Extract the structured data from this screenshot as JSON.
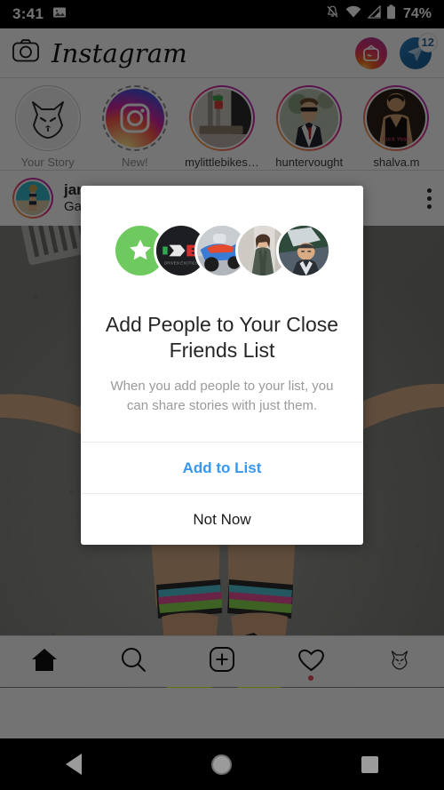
{
  "status_bar": {
    "time": "3:41",
    "icons": [
      "photo-icon",
      "notifications-off-icon",
      "wifi-icon",
      "cellular-signal-icon",
      "battery-icon"
    ],
    "battery_text": "74%"
  },
  "app_header": {
    "camera_icon": "camera-icon",
    "title": "Instagram",
    "igtv_icon": "igtv-icon",
    "direct_icon": "direct-messages-icon",
    "direct_badge": "12"
  },
  "stories": [
    {
      "label": "Your Story",
      "avatar": "wolf-avatar",
      "ring": "plain"
    },
    {
      "label": "New!",
      "avatar": "instagram-glyph-avatar",
      "ring": "dashed"
    },
    {
      "label": "mylittlebikes…",
      "avatar": "bike-photo-avatar",
      "ring": "gradient"
    },
    {
      "label": "huntervought",
      "avatar": "man-suit-photo-avatar",
      "ring": "gradient"
    },
    {
      "label": "shalva.m",
      "avatar": "man-tanktop-photo-avatar",
      "ring": "gradient"
    }
  ],
  "post": {
    "username": "jan",
    "location": "Gas",
    "more_icon": "overflow-menu-icon",
    "avatar": "woman-beach-photo-avatar",
    "photo": "athlete-legs-dumbbell-photo"
  },
  "dialog": {
    "avatars": [
      "close-friends-star-icon",
      "driven-exotics-logo-avatar",
      "motorcycle-photo-avatar",
      "woman-photo-avatar",
      "man-photo-avatar"
    ],
    "title": "Add People to Your Close Friends List",
    "body": "When you add people to your list, you can share stories with just them.",
    "primary_button": "Add to List",
    "secondary_button": "Not Now",
    "accent_color": "#3897f0",
    "star_circle_color": "#6ec95e"
  },
  "tabbar": [
    {
      "name": "home",
      "icon": "home-icon",
      "active": true
    },
    {
      "name": "search",
      "icon": "search-icon",
      "active": false
    },
    {
      "name": "create",
      "icon": "plus-square-icon",
      "active": false
    },
    {
      "name": "activity",
      "icon": "heart-icon",
      "active": false,
      "badge": true
    },
    {
      "name": "profile",
      "icon": "profile-avatar-icon",
      "active": false
    }
  ],
  "android_nav": {
    "back": "back-triangle-icon",
    "home": "home-circle-icon",
    "recents": "recents-square-icon"
  }
}
